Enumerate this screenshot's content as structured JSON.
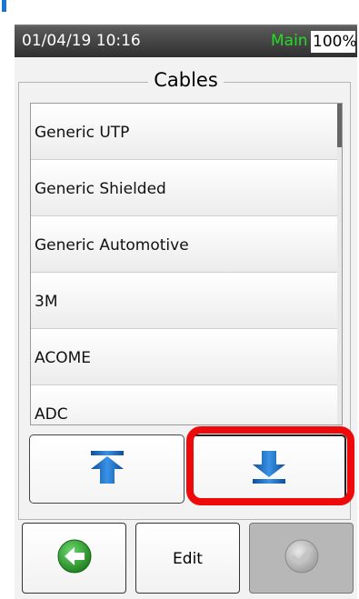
{
  "status": {
    "datetime": "01/04/19 10:16",
    "mode": "Main",
    "battery": "100%"
  },
  "panel": {
    "title": "Cables"
  },
  "list": {
    "items": [
      {
        "label": "Generic UTP"
      },
      {
        "label": "Generic Shielded"
      },
      {
        "label": "Generic Automotive"
      },
      {
        "label": "3M"
      },
      {
        "label": "ACOME"
      },
      {
        "label": "ADC"
      }
    ]
  },
  "buttons": {
    "edit_label": "Edit"
  },
  "icons": {
    "scroll_top": "arrow-to-top-icon",
    "scroll_down": "arrow-down-icon",
    "back": "back-arrow-icon",
    "confirm": "checkmark-icon"
  },
  "colors": {
    "highlight": "#ee0a0a",
    "arrow": "#1a73c9",
    "mode": "#22dd22",
    "back": "#2a9a2a"
  }
}
